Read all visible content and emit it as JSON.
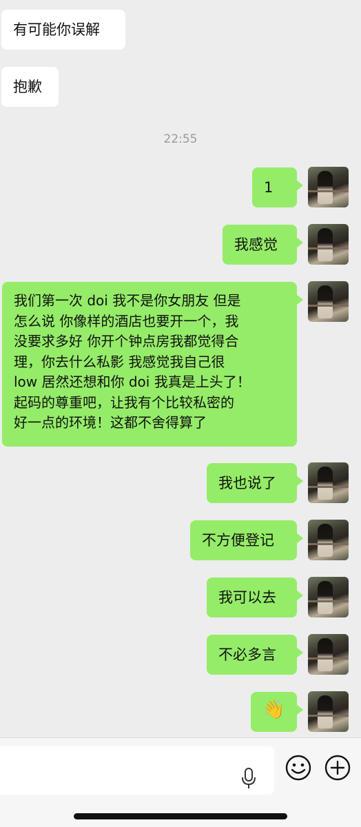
{
  "chat": {
    "incoming": [
      "有可能你误解",
      "抱歉"
    ],
    "timestamp": "22:55",
    "outgoing": [
      "1",
      "我感觉",
      "我们第一次 doi 我不是你女朋友 但是\n怎么说 你像样的酒店也要开一个，我\n没要求多好 你开个钟点房我都觉得合\n理，你去什么私影 我感觉我自己很\nlow 居然还想和你 doi 我真是上头了！\n起码的尊重吧，让我有个比较私密的\n好一点的环境！这都不舍得算了",
      "我也说了",
      "不方便登记",
      "我可以去",
      "不必多言",
      "👋"
    ]
  },
  "input_bar": {
    "mic_icon": "microphone-icon",
    "emoji_icon": "smiley-icon",
    "plus_icon": "plus-icon"
  },
  "colors": {
    "outgoing_bubble": "#95ec69",
    "incoming_bubble": "#ffffff",
    "background": "#ededed"
  }
}
